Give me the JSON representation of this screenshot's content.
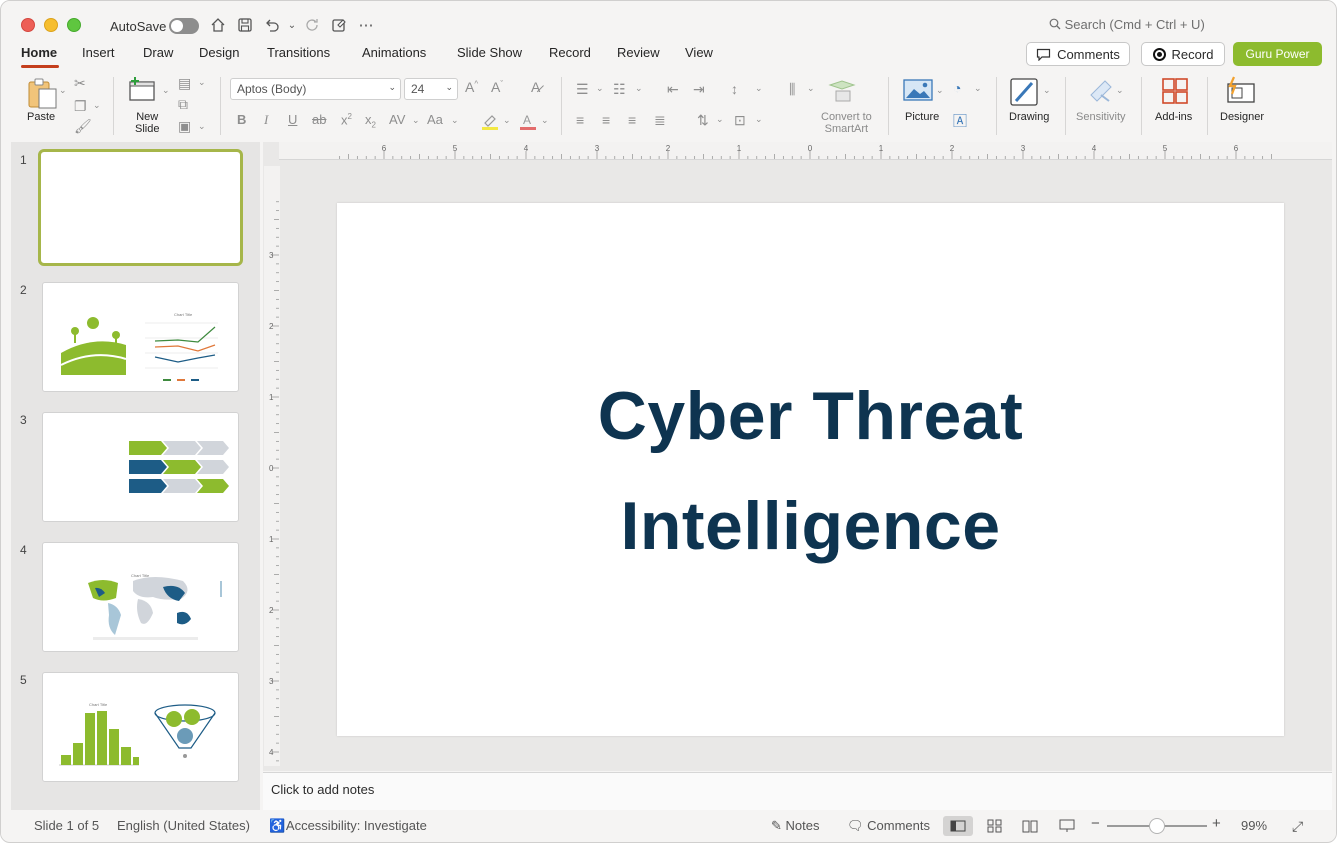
{
  "titlebar": {
    "autosave_label": "AutoSave",
    "search_placeholder": "Search (Cmd + Ctrl + U)",
    "more": "⋯"
  },
  "tabs": [
    "Home",
    "Insert",
    "Draw",
    "Design",
    "Transitions",
    "Animations",
    "Slide Show",
    "Record",
    "Review",
    "View"
  ],
  "actions": {
    "comments": "Comments",
    "record": "Record",
    "guru": "Guru Power"
  },
  "ribbon": {
    "paste": "Paste",
    "new_slide": "New\nSlide",
    "font_name": "Aptos (Body)",
    "font_size": "24",
    "convert": "Convert to\nSmartArt",
    "picture": "Picture",
    "drawing": "Drawing",
    "sensitivity": "Sensitivity",
    "addins": "Add-ins",
    "designer": "Designer"
  },
  "thumbnails": [
    "1",
    "2",
    "3",
    "4",
    "5"
  ],
  "thumb_titles": {
    "chart": "Chart Title"
  },
  "slide": {
    "title_line1": "Cyber Threat",
    "title_line2": "Intelligence"
  },
  "notes_placeholder": "Click to add notes",
  "status": {
    "slide_of": "Slide 1 of 5",
    "language": "English (United States)",
    "accessibility": "Accessibility: Investigate",
    "notes": "Notes",
    "comments": "Comments",
    "zoom": "99%"
  },
  "colors": {
    "accent_green": "#8dbb2e",
    "title_navy": "#0e3450",
    "tab_underline": "#c43e1c",
    "chart_blue": "#1d5c86"
  }
}
